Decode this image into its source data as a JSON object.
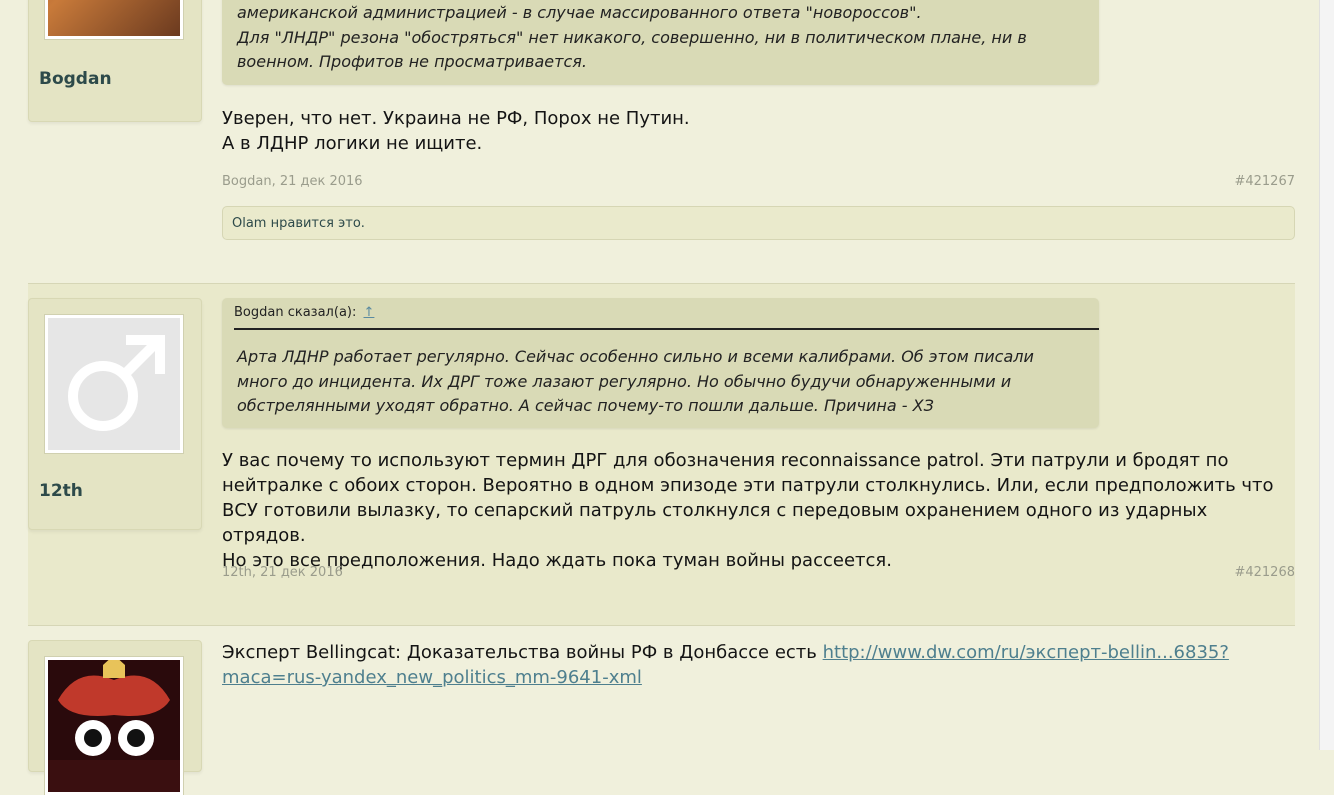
{
  "posts": [
    {
      "username": "Bogdan",
      "quote_lines": [
        "американской администрацией - в случае массированного ответа \"новороссов\".",
        "Для \"ЛНДР\" резона \"обостряться\" нет никакого, совершенно, ни в политическом плане, ни в",
        "военном. Профитов не просматривается."
      ],
      "message_lines": [
        "Уверен, что нет. Украина не РФ, Порох не Путин.",
        "А в ЛДНР логики не ищите."
      ],
      "author_date": "Bogdan, 21 дек 2016",
      "post_number": "#421267",
      "likes": "Olam нравится это."
    },
    {
      "username": "12th",
      "quote_author": "Bogdan сказал(а):",
      "quote_arrow": "↑",
      "quote_lines": [
        "Арта ЛДНР работает регулярно. Сейчас особенно сильно и всеми калибрами. Об этом писали",
        "много до инцидента. Их ДРГ тоже лазают регулярно. Но обычно будучи обнаруженными и",
        "обстрелянными уходят обратно. А сейчас почему-то пошли дальше. Причина - ХЗ"
      ],
      "message_lines": [
        "У вас почему то используют термин ДРГ для обозначения reconnaissance patrol. Эти патрули и бродят по",
        "нейтралке с обоих сторон. Вероятно в одном эпизоде эти патрули столкнулись. Или, если предположить что",
        "ВСУ готовили вылазку, то сепарский патруль столкнулся с передовым охранением одного из ударных отрядов.",
        "Но это все предположения. Надо ждать пока туман войны рассеется."
      ],
      "author_date": "12th, 21 дек 2016",
      "post_number": "#421268"
    },
    {
      "message_text": "Эксперт Bellingcat: Доказательства войны РФ в Донбассе есть ",
      "link_line1": "http://www.dw.com/ru/эксперт-bellin...6835?",
      "link_line2": "maca=rus-yandex_new_politics_mm-9641-xml"
    }
  ],
  "colors": {
    "page_bg": "#f0f0dc",
    "highlight_post_bg": "#e9e9cb",
    "quote_bg": "#d9dab6",
    "username": "#2d4a4a",
    "link": "#4e7f8e",
    "meta": "#9a9c8c"
  }
}
